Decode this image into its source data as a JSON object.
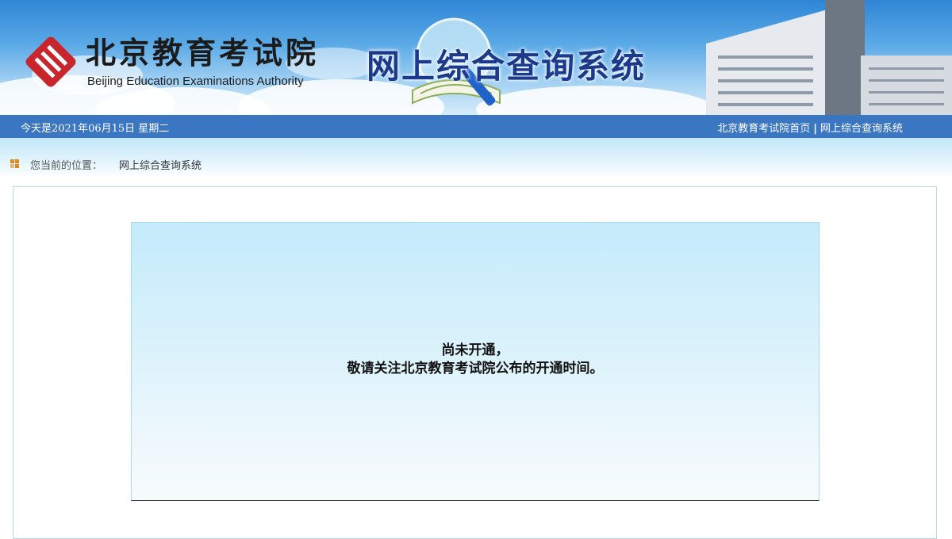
{
  "header": {
    "logo_cn": "北京教育考试院",
    "logo_en": "Beijing Education Examinations Authority",
    "system_title": "网上综合查询系统",
    "logo_icon": "beijing-education-logo-icon",
    "colors": {
      "title": "#1c3a8c",
      "logo_red": "#c8262c"
    }
  },
  "topbar": {
    "date": "今天是2021年06月15日  星期二",
    "links": [
      "北京教育考试院首页",
      "网上综合查询系统"
    ],
    "separator": "|",
    "color": "#3b76c2"
  },
  "breadcrumb": {
    "icon": "grid-bullet-icon",
    "label": "您当前的位置：",
    "current": "网上综合查询系统"
  },
  "notice": {
    "line1": "尚未开通，",
    "line2": "敬请关注北京教育考试院公布的开通时间。"
  }
}
